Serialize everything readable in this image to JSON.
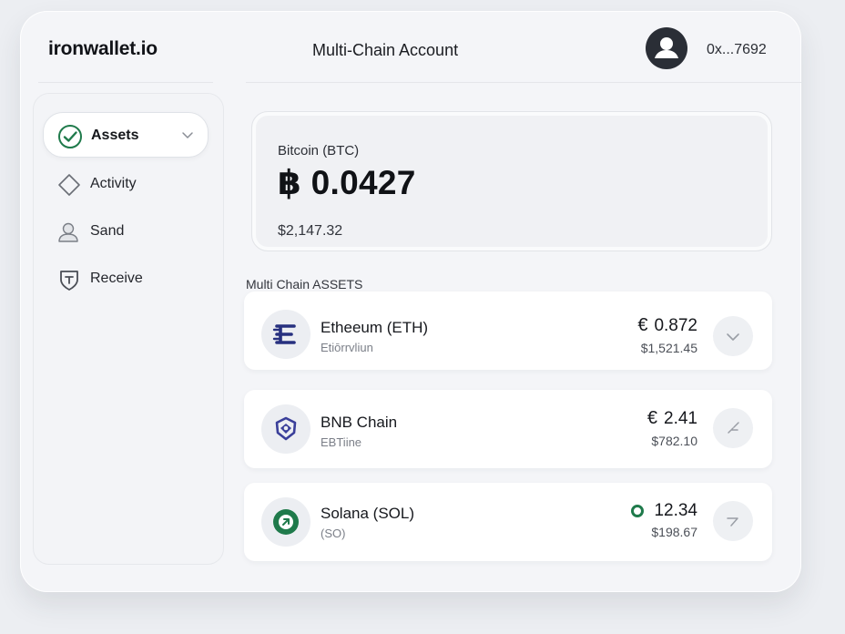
{
  "header": {
    "brand": "ironwallet.io",
    "title": "Multi-Chain Account",
    "address": "0x...7692",
    "avatar_icon": "user-avatar-icon"
  },
  "sidebar": {
    "items": [
      {
        "label": "Assets",
        "icon": "check-circle-icon",
        "active": true
      },
      {
        "label": "Activity",
        "icon": "diamond-icon",
        "active": false
      },
      {
        "label": "Sand",
        "icon": "person-icon",
        "active": false
      },
      {
        "label": "Receive",
        "icon": "shield-icon",
        "active": false
      }
    ]
  },
  "hero": {
    "name": "Bitcoin (BTC)",
    "amount": "฿ 0.0427",
    "fiat": "$2,147.32"
  },
  "section_label": "Multi Chain ASSETS",
  "assets": [
    {
      "name": "Etheeum (ETH)",
      "sub": "Etiōrrvliun",
      "symbol": "€",
      "amount": "0.872",
      "fiat": "$1,521.45",
      "icon": "ethereum-logo-icon",
      "action_icon": "chevron-down-icon"
    },
    {
      "name": "BNB Chain",
      "sub": "EBTiine",
      "symbol": "€",
      "amount": "2.41",
      "fiat": "$782.10",
      "icon": "bnb-logo-icon",
      "action_icon": "expand-icon"
    },
    {
      "name": "Solana (SOL)",
      "sub": "(SO)",
      "symbol": "",
      "amount": "12.34",
      "fiat": "$198.67",
      "icon": "solana-logo-icon",
      "action_icon": "arrow-icon"
    }
  ],
  "colors": {
    "accent_green": "#1f7a4b",
    "eth_blue": "#27307f",
    "bnb_blue": "#3a3f9a"
  }
}
